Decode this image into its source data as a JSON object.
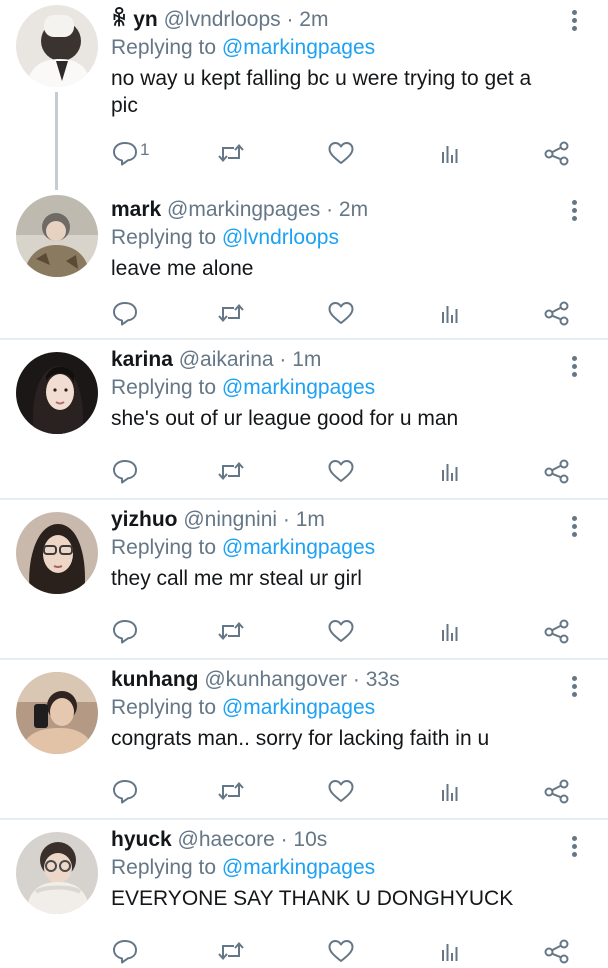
{
  "tweets": [
    {
      "name": "ꆜ yn",
      "handle_time": "@lvndrloops · 2m",
      "replying_prefix": "Replying to",
      "replying_to": "@markingpages",
      "text": "no way u kept falling bc u were trying to get a pic",
      "reply_count": "1"
    },
    {
      "name": "mark",
      "handle_time": "@markingpages · 2m",
      "replying_prefix": "Replying to",
      "replying_to": "@lvndrloops",
      "text": "leave me alone",
      "reply_count": ""
    },
    {
      "name": "karina",
      "handle_time": "@aikarina · 1m",
      "replying_prefix": "Replying to",
      "replying_to": "@markingpages",
      "text": "she's out of ur league good for u man",
      "reply_count": ""
    },
    {
      "name": "yizhuo",
      "handle_time": "@ningnini · 1m",
      "replying_prefix": "Replying to",
      "replying_to": "@markingpages",
      "text": "they call me mr steal ur girl",
      "reply_count": ""
    },
    {
      "name": "kunhang",
      "handle_time": "@kunhangover · 33s",
      "replying_prefix": "Replying to",
      "replying_to": "@markingpages",
      "text": "congrats man.. sorry for lacking faith in u",
      "reply_count": ""
    },
    {
      "name": "hyuck",
      "handle_time": "@haecore · 10s",
      "replying_prefix": "Replying to",
      "replying_to": "@markingpages",
      "text": "EVERYONE SAY THANK U DONGHYUCK",
      "reply_count": ""
    }
  ],
  "colors": {
    "mention": "#1da1f2",
    "meta": "#657786",
    "separator": "#e6ecf0",
    "thread_line": "#c4ccd3"
  },
  "icons": [
    "reply-icon",
    "retweet-icon",
    "like-icon",
    "analytics-icon",
    "share-icon",
    "more-icon"
  ]
}
